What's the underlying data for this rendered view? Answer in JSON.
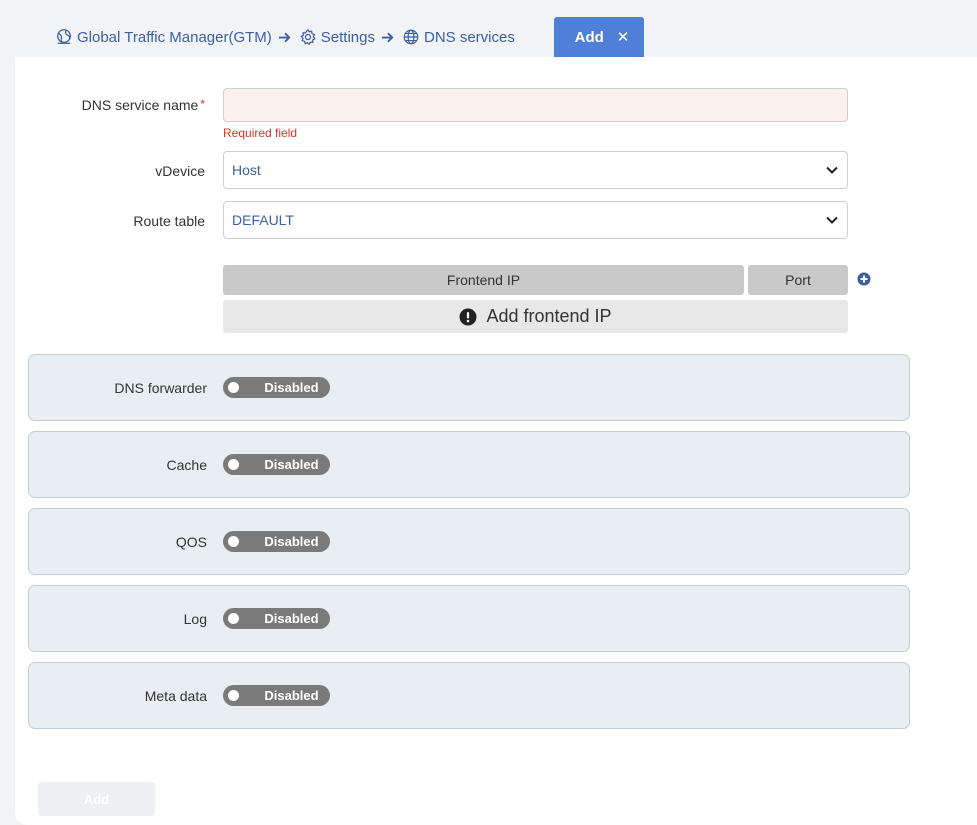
{
  "breadcrumb": {
    "items": [
      {
        "label": "Global Traffic Manager(GTM)",
        "icon": "globe-network-icon"
      },
      {
        "label": "Settings",
        "icon": "gear-icon"
      },
      {
        "label": "DNS services",
        "icon": "globe-icon"
      }
    ]
  },
  "tab": {
    "label": "Add",
    "close": "✕"
  },
  "form": {
    "name_label": "DNS service name",
    "required_star": "*",
    "name_value": "",
    "required_msg": "Required field",
    "vdevice_label": "vDevice",
    "vdevice_value": "Host",
    "route_label": "Route table",
    "route_value": "DEFAULT",
    "frontend_header": "Frontend IP",
    "port_header": "Port",
    "add_frontend_label": "Add frontend IP"
  },
  "sections": [
    {
      "label": "DNS forwarder",
      "toggle": "Disabled"
    },
    {
      "label": "Cache",
      "toggle": "Disabled"
    },
    {
      "label": "QOS",
      "toggle": "Disabled"
    },
    {
      "label": "Log",
      "toggle": "Disabled"
    },
    {
      "label": "Meta data",
      "toggle": "Disabled"
    }
  ],
  "submit_label": "Add",
  "colors": {
    "accent": "#4f7fd6",
    "link": "#3d5fa0",
    "error": "#d9342b",
    "toggle_off": "#7a7a7a"
  }
}
